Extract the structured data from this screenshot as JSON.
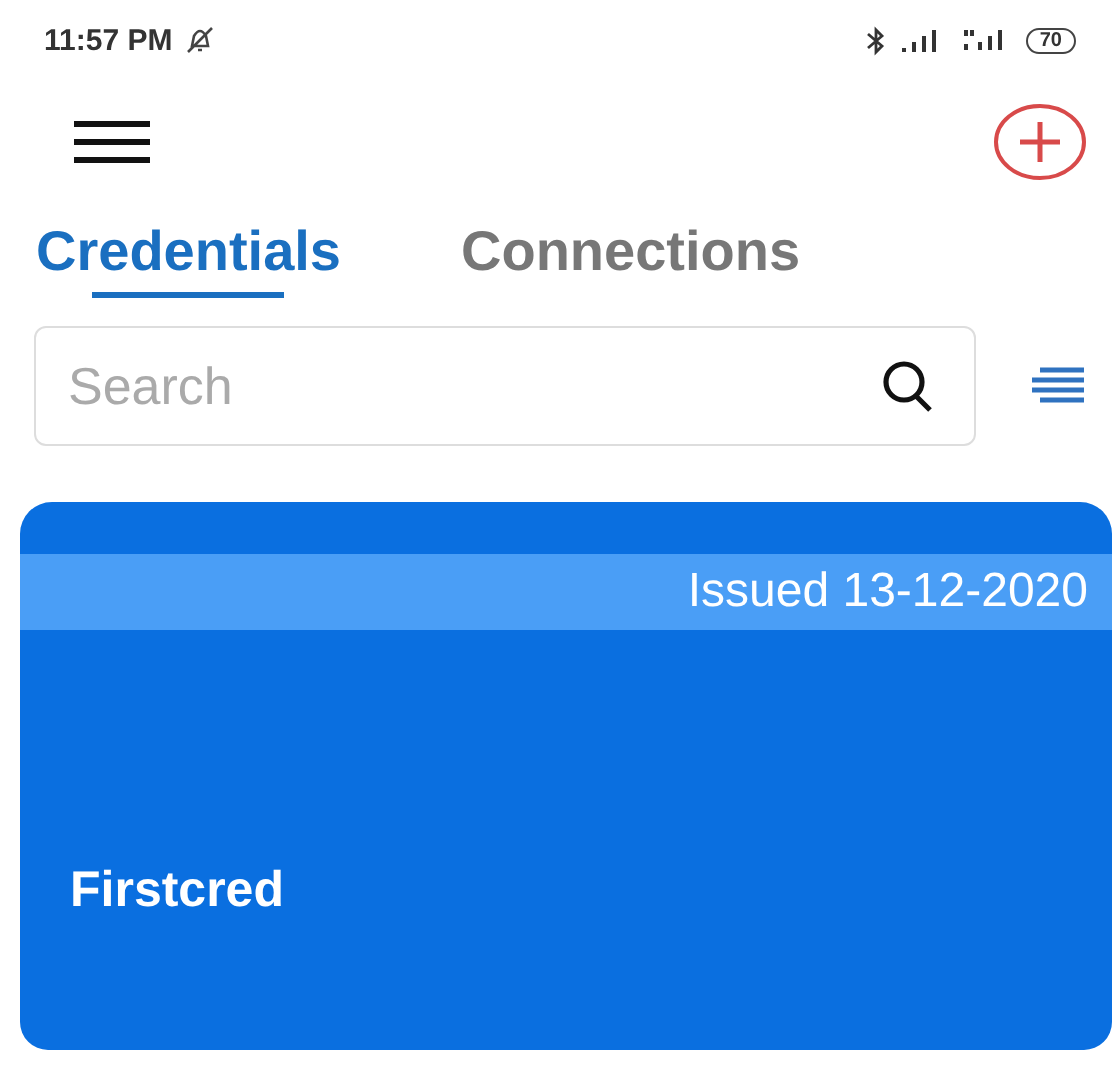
{
  "status_bar": {
    "time": "11:57 PM",
    "battery": "70"
  },
  "tabs": [
    {
      "label": "Credentials",
      "selected": true
    },
    {
      "label": "Connections",
      "selected": false
    }
  ],
  "search": {
    "placeholder": "Search"
  },
  "credentials": [
    {
      "issued": "Issued 13-12-2020",
      "name": "Firstcred"
    }
  ]
}
